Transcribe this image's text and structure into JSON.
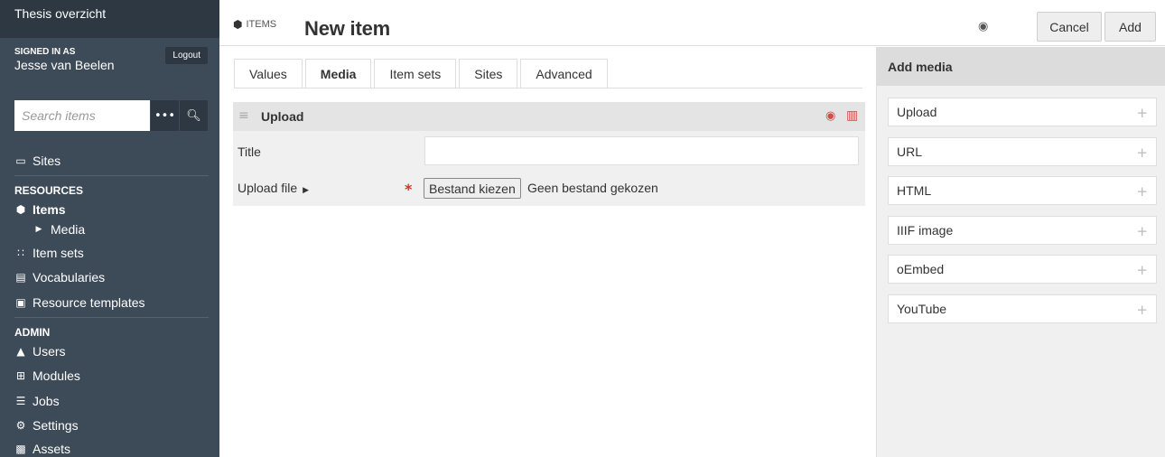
{
  "sidebar": {
    "site_title": "Thesis overzicht",
    "signed_in_label": "SIGNED IN AS",
    "user_name": "Jesse van Beelen",
    "logout_label": "Logout",
    "search_placeholder": "Search items",
    "nav": {
      "sites": "Sites",
      "resources_label": "RESOURCES",
      "items": "Items",
      "media": "Media",
      "item_sets": "Item sets",
      "vocabularies": "Vocabularies",
      "resource_templates": "Resource templates",
      "admin_label": "ADMIN",
      "users": "Users",
      "modules": "Modules",
      "jobs": "Jobs",
      "settings": "Settings",
      "assets": "Assets"
    }
  },
  "header": {
    "crumb": "ITEMS",
    "title": "New item",
    "cancel_label": "Cancel",
    "add_label": "Add"
  },
  "tabs": [
    "Values",
    "Media",
    "Item sets",
    "Sites",
    "Advanced"
  ],
  "active_tab": "Media",
  "upload_panel": {
    "title": "Upload",
    "title_field_label": "Title",
    "title_value": "",
    "upload_file_label": "Upload file",
    "choose_button": "Bestand kiezen",
    "no_file_text": "Geen bestand gekozen"
  },
  "add_media": {
    "heading": "Add media",
    "options": [
      "Upload",
      "URL",
      "HTML",
      "IIIF image",
      "oEmbed",
      "YouTube"
    ]
  },
  "colors": {
    "sidebar_bg": "#3d4a58",
    "sidebar_dark": "#2d3842",
    "danger": "#d64a4a"
  }
}
